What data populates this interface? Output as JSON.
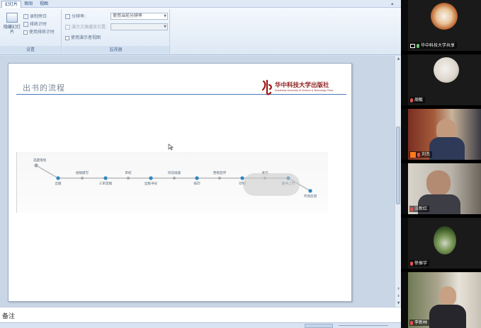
{
  "ribbon": {
    "tabs": [
      {
        "label": "幻灯片"
      },
      {
        "label": "审阅"
      },
      {
        "label": "视图"
      }
    ],
    "groups": {
      "setup": {
        "label": "设置",
        "big_button_label": "隐藏幻灯片",
        "buttons": [
          "录制旁白",
          "排练计时",
          "使用排练计时"
        ]
      },
      "monitors": {
        "label": "监视器",
        "resolution_label": "分辨率:",
        "resolution_value": "使用当前分辨率",
        "show_on_label": "演示文稿播放位置:",
        "show_on_value": "",
        "presenter_view_label": "使用演示者视图"
      }
    }
  },
  "slide": {
    "title": "出书的流程",
    "publisher_name": "华中科技大学出版社",
    "publisher_name_en": "Huazhong University of Science & Technology Press",
    "flow_steps_top": [
      "选题策划",
      "组稿撰写",
      "审校",
      "印前排版",
      "营销宣传",
      "发行"
    ],
    "flow_steps_bottom": [
      "出版",
      "三审定稿",
      "出版书号",
      "排印",
      "印制",
      "图书上市",
      "市场反馈"
    ],
    "flow_color": "#2e86c1"
  },
  "notes": {
    "label": "备注"
  },
  "participants": [
    {
      "name": "华中科技大学共享",
      "mic": "on",
      "sharing": true
    },
    {
      "name": "周敏",
      "mic": "off"
    },
    {
      "name": "刘杰",
      "mic": "off",
      "host": true
    },
    {
      "name": "汪新红",
      "mic": "off"
    },
    {
      "name": "徐振宇",
      "mic": "off"
    },
    {
      "name": "李新林",
      "mic": "off"
    }
  ],
  "colors": {
    "ribbon_bg": "#dde8f5",
    "slide_bg": "#ffffff",
    "accent_rule": "#4a78b8",
    "publisher_red": "#8d1c1c",
    "video_panel_bg": "#0b0b0b"
  }
}
